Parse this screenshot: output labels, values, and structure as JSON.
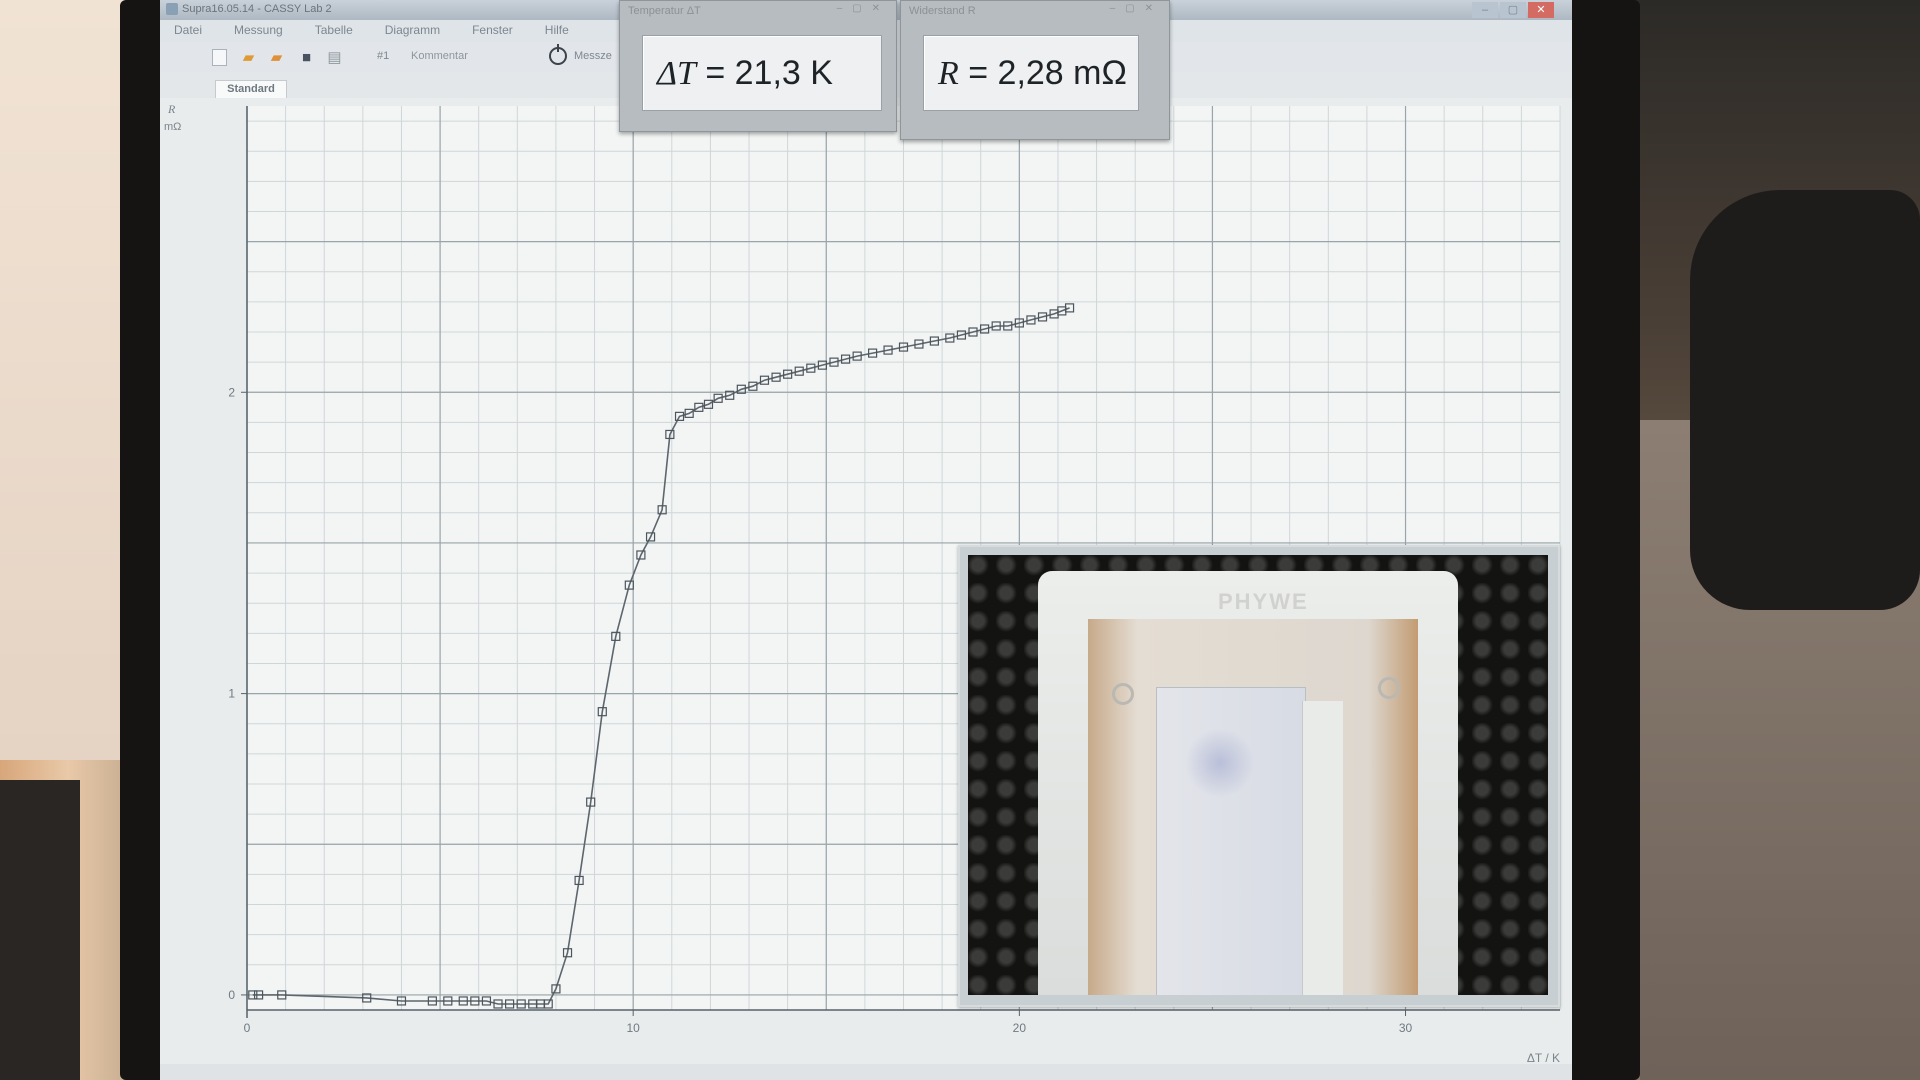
{
  "app": {
    "window_title": "Supra16.05.14 - CASSY Lab 2"
  },
  "menu": [
    "Datei",
    "Messung",
    "Tabelle",
    "Diagramm",
    "Fenster",
    "Hilfe"
  ],
  "toolbar": {
    "comment_id": "#1",
    "comment_label": "Kommentar",
    "measure_label": "Messze"
  },
  "tabs": {
    "standard": "Standard"
  },
  "meters": {
    "temperature": {
      "title": "Temperatur ΔT",
      "symbol": "ΔT",
      "value": "= 21,3 K"
    },
    "resistance": {
      "title": "Widerstand R",
      "symbol": "R",
      "value": "= 2,28 mΩ"
    }
  },
  "webcam": {
    "logo": "PHYWE"
  },
  "chart_data": {
    "type": "line",
    "xlabel": "ΔT / K",
    "ylabel": "R",
    "yunit": "mΩ",
    "xlim": [
      0,
      34
    ],
    "ylim": [
      -0.05,
      2.95
    ],
    "xticks": [
      0,
      10,
      20,
      30
    ],
    "yticks": [
      0,
      1,
      2
    ],
    "grid": true,
    "series": [
      {
        "marker": "square",
        "x": [
          0.15,
          0.3,
          0.9,
          3.1,
          4.0,
          4.8,
          5.2,
          5.6,
          5.9,
          6.2,
          6.5,
          6.8,
          7.1,
          7.4,
          7.6,
          7.8,
          8.0,
          8.3,
          8.6,
          8.9,
          9.2,
          9.55,
          9.9,
          10.2,
          10.45,
          10.75,
          10.95,
          11.2,
          11.45,
          11.7,
          11.95,
          12.2,
          12.5,
          12.8,
          13.1,
          13.4,
          13.7,
          14.0,
          14.3,
          14.6,
          14.9,
          15.2,
          15.5,
          15.8,
          16.2,
          16.6,
          17.0,
          17.4,
          17.8,
          18.2,
          18.5,
          18.8,
          19.1,
          19.4,
          19.7,
          20.0,
          20.3,
          20.6,
          20.9,
          21.1,
          21.3
        ],
        "y": [
          0.0,
          0.0,
          0.0,
          -0.01,
          -0.02,
          -0.02,
          -0.02,
          -0.02,
          -0.02,
          -0.02,
          -0.03,
          -0.03,
          -0.03,
          -0.03,
          -0.03,
          -0.03,
          0.02,
          0.14,
          0.38,
          0.64,
          0.94,
          1.19,
          1.36,
          1.46,
          1.52,
          1.61,
          1.86,
          1.92,
          1.93,
          1.95,
          1.96,
          1.98,
          1.99,
          2.01,
          2.02,
          2.04,
          2.05,
          2.06,
          2.07,
          2.08,
          2.09,
          2.1,
          2.11,
          2.12,
          2.13,
          2.14,
          2.15,
          2.16,
          2.17,
          2.18,
          2.19,
          2.2,
          2.21,
          2.22,
          2.22,
          2.23,
          2.24,
          2.25,
          2.26,
          2.27,
          2.28
        ]
      }
    ]
  }
}
